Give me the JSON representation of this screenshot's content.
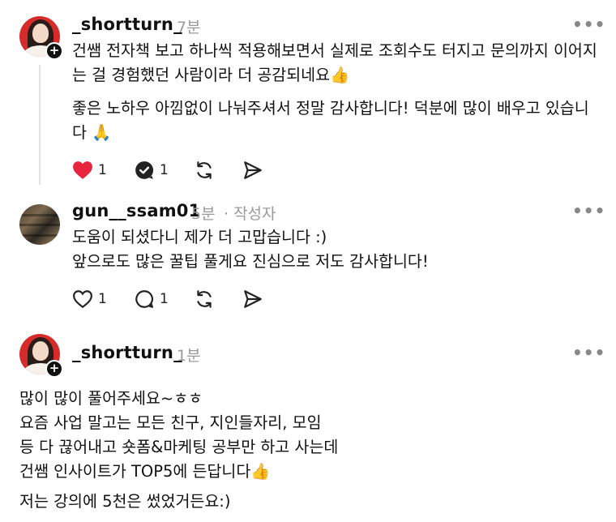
{
  "comments": [
    {
      "username": "_shortturn_",
      "time": "7분",
      "more": "•••",
      "paragraphs": [
        "건쌤 전자책 보고 하나씩 적용해보면서 실제로 조회수도 터지고 문의까지 이어지는 걸 경험했던 사람이라 더 공감되네요👍",
        "좋은 노하우 아낌없이 나눠주셔서 정말 감사합니다! 덕분에 많이 배우고 있습니다 🙏"
      ],
      "like_count": "1",
      "reply_count": "1"
    },
    {
      "username": "gun__ssam01",
      "time": "5분",
      "author_tag": "· 작성자",
      "more": "•••",
      "lines": [
        "도움이 되셨다니 제가 더 고맙습니다 :)",
        "앞으로도 많은 꿀팁 풀게요 진심으로 저도 감사합니다!"
      ],
      "like_count": "1",
      "reply_count": "1"
    },
    {
      "username": "_shortturn_",
      "time": "1분",
      "more": "•••",
      "lines": [
        "많이 많이 풀어주세요~ㅎㅎ",
        "요즘 사업 말고는 모든 친구, 지인들자리, 모임",
        "등 다 끊어내고 숏폼&마케팅 공부만 하고 사는데",
        "건쌤 인사이트가 TOP5에 든답니다👍",
        "저는 강의에 5천은 썼었거든요:)"
      ]
    }
  ],
  "colors": {
    "like_active": "#e8253f",
    "muted": "#9a9a9a",
    "badge": "#101010"
  }
}
